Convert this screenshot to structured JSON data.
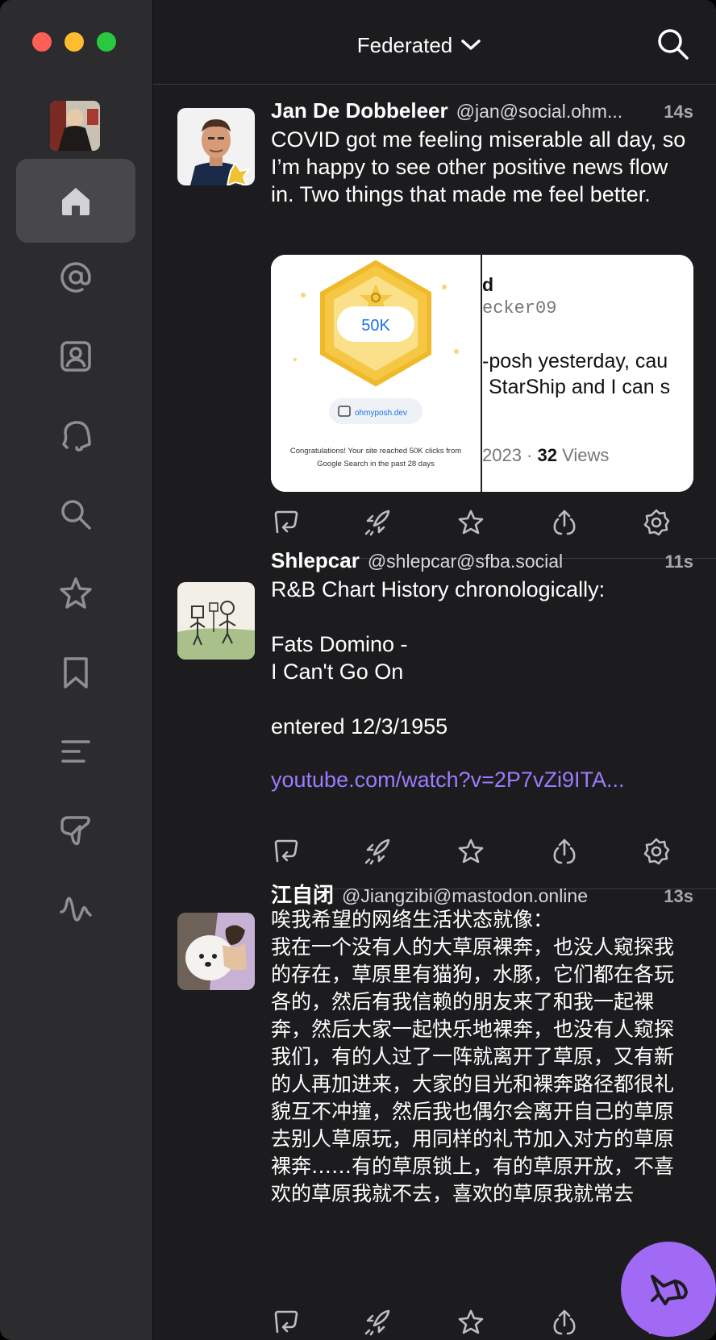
{
  "window": {
    "controls": [
      "close",
      "minimize",
      "zoom"
    ]
  },
  "sidebar": {
    "account_avatar": "account-avatar",
    "items": [
      {
        "name": "home",
        "icon": "home-icon",
        "active": true
      },
      {
        "name": "mentions",
        "icon": "at-icon",
        "active": false
      },
      {
        "name": "profile",
        "icon": "contact-card-icon",
        "active": false
      },
      {
        "name": "notifications",
        "icon": "bell-icon",
        "active": false
      },
      {
        "name": "explore",
        "icon": "search-icon",
        "active": false
      },
      {
        "name": "favorites",
        "icon": "star-icon",
        "active": false
      },
      {
        "name": "bookmarks",
        "icon": "bookmark-icon",
        "active": false
      },
      {
        "name": "lists",
        "icon": "list-icon",
        "active": false
      },
      {
        "name": "messages",
        "icon": "message-icon",
        "active": false
      },
      {
        "name": "activity",
        "icon": "activity-icon",
        "active": false
      }
    ]
  },
  "header": {
    "timeline_label": "Federated",
    "search_icon": "search-icon"
  },
  "posts": [
    {
      "name": "Jan De Dobbeleer",
      "handle": "@jan@social.ohm...",
      "time": "14s",
      "text": "COVID got me feeling miserable all day, so I’m happy to see other positive news flow in. Two things that made me feel better.",
      "media": {
        "left": {
          "badge_value": "50K",
          "site_chip": "ohmyposh.dev",
          "caption": "Congratulations! Your site reached 50K clicks from Google Search in the past 28 days"
        },
        "right": {
          "line1": "d",
          "line2": "ecker09",
          "line3": "-posh yesterday, cau",
          "line4": "StarShip and I can s",
          "footer_year": "2023 · ",
          "footer_count": "32",
          "footer_views": " Views"
        }
      }
    },
    {
      "name": "Shlepcar",
      "handle": "@shlepcar@sfba.social",
      "time": "11s",
      "text": "R&B Chart History chronologically:\n\nFats Domino -\nI Can't Go On\n\nentered 12/3/1955",
      "link": "youtube.com/watch?v=2P7vZi9ITA..."
    },
    {
      "name": "江自闭",
      "handle": "@Jiangzibi@mastodon.online",
      "time": "13s",
      "text": "唉我希望的网络生活状态就像：\n我在一个没有人的大草原裸奔，也没人窥探我的存在，草原里有猫狗，水豚，它们都在各玩各的，然后有我信赖的朋友来了和我一起裸奔，然后大家一起快乐地裸奔，也没有人窥探我们，有的人过了一阵就离开了草原，又有新的人再加进来，大家的目光和裸奔路径都很礼貌互不冲撞，然后我也偶尔会离开自己的草原去别人草原玩，用同样的礼节加入对方的草原裸奔……有的草原锁上，有的草原开放，不喜欢的草原我就不去，喜欢的草原我就常去"
    }
  ],
  "post_actions": [
    "reply-icon",
    "boost-icon",
    "favorite-icon",
    "share-icon",
    "more-icon"
  ],
  "compose_button": {
    "icon": "megaphone-icon",
    "color": "#a06af5"
  }
}
